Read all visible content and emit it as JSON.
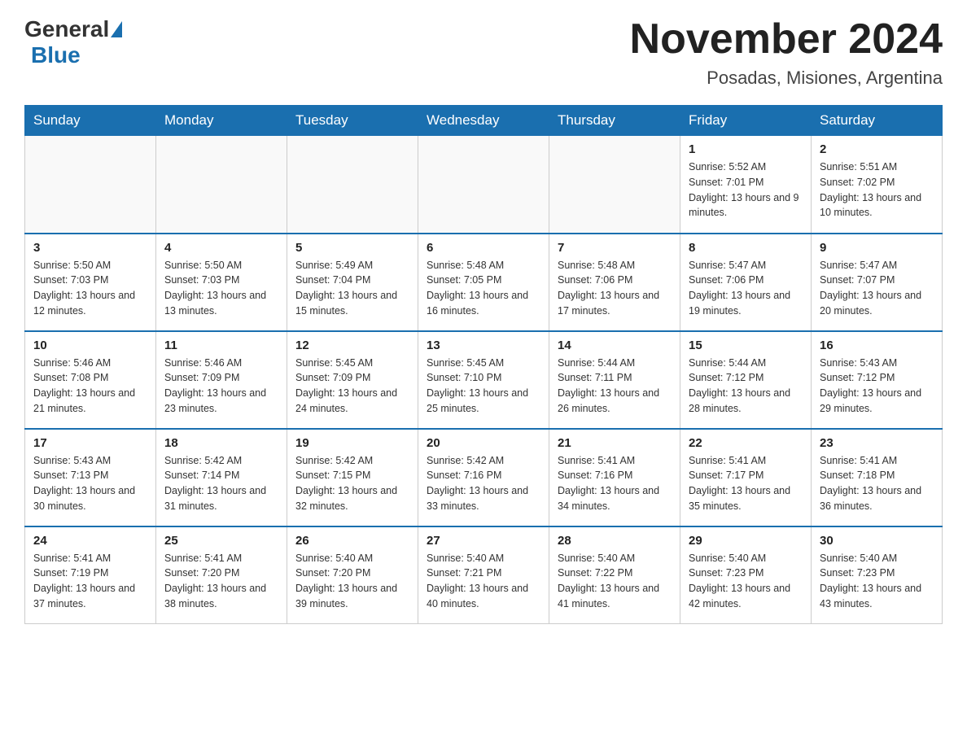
{
  "header": {
    "logo": {
      "general": "General",
      "blue": "Blue"
    },
    "title": "November 2024",
    "location": "Posadas, Misiones, Argentina"
  },
  "days_of_week": [
    "Sunday",
    "Monday",
    "Tuesday",
    "Wednesday",
    "Thursday",
    "Friday",
    "Saturday"
  ],
  "weeks": [
    [
      {
        "day": "",
        "info": ""
      },
      {
        "day": "",
        "info": ""
      },
      {
        "day": "",
        "info": ""
      },
      {
        "day": "",
        "info": ""
      },
      {
        "day": "",
        "info": ""
      },
      {
        "day": "1",
        "info": "Sunrise: 5:52 AM\nSunset: 7:01 PM\nDaylight: 13 hours and 9 minutes."
      },
      {
        "day": "2",
        "info": "Sunrise: 5:51 AM\nSunset: 7:02 PM\nDaylight: 13 hours and 10 minutes."
      }
    ],
    [
      {
        "day": "3",
        "info": "Sunrise: 5:50 AM\nSunset: 7:03 PM\nDaylight: 13 hours and 12 minutes."
      },
      {
        "day": "4",
        "info": "Sunrise: 5:50 AM\nSunset: 7:03 PM\nDaylight: 13 hours and 13 minutes."
      },
      {
        "day": "5",
        "info": "Sunrise: 5:49 AM\nSunset: 7:04 PM\nDaylight: 13 hours and 15 minutes."
      },
      {
        "day": "6",
        "info": "Sunrise: 5:48 AM\nSunset: 7:05 PM\nDaylight: 13 hours and 16 minutes."
      },
      {
        "day": "7",
        "info": "Sunrise: 5:48 AM\nSunset: 7:06 PM\nDaylight: 13 hours and 17 minutes."
      },
      {
        "day": "8",
        "info": "Sunrise: 5:47 AM\nSunset: 7:06 PM\nDaylight: 13 hours and 19 minutes."
      },
      {
        "day": "9",
        "info": "Sunrise: 5:47 AM\nSunset: 7:07 PM\nDaylight: 13 hours and 20 minutes."
      }
    ],
    [
      {
        "day": "10",
        "info": "Sunrise: 5:46 AM\nSunset: 7:08 PM\nDaylight: 13 hours and 21 minutes."
      },
      {
        "day": "11",
        "info": "Sunrise: 5:46 AM\nSunset: 7:09 PM\nDaylight: 13 hours and 23 minutes."
      },
      {
        "day": "12",
        "info": "Sunrise: 5:45 AM\nSunset: 7:09 PM\nDaylight: 13 hours and 24 minutes."
      },
      {
        "day": "13",
        "info": "Sunrise: 5:45 AM\nSunset: 7:10 PM\nDaylight: 13 hours and 25 minutes."
      },
      {
        "day": "14",
        "info": "Sunrise: 5:44 AM\nSunset: 7:11 PM\nDaylight: 13 hours and 26 minutes."
      },
      {
        "day": "15",
        "info": "Sunrise: 5:44 AM\nSunset: 7:12 PM\nDaylight: 13 hours and 28 minutes."
      },
      {
        "day": "16",
        "info": "Sunrise: 5:43 AM\nSunset: 7:12 PM\nDaylight: 13 hours and 29 minutes."
      }
    ],
    [
      {
        "day": "17",
        "info": "Sunrise: 5:43 AM\nSunset: 7:13 PM\nDaylight: 13 hours and 30 minutes."
      },
      {
        "day": "18",
        "info": "Sunrise: 5:42 AM\nSunset: 7:14 PM\nDaylight: 13 hours and 31 minutes."
      },
      {
        "day": "19",
        "info": "Sunrise: 5:42 AM\nSunset: 7:15 PM\nDaylight: 13 hours and 32 minutes."
      },
      {
        "day": "20",
        "info": "Sunrise: 5:42 AM\nSunset: 7:16 PM\nDaylight: 13 hours and 33 minutes."
      },
      {
        "day": "21",
        "info": "Sunrise: 5:41 AM\nSunset: 7:16 PM\nDaylight: 13 hours and 34 minutes."
      },
      {
        "day": "22",
        "info": "Sunrise: 5:41 AM\nSunset: 7:17 PM\nDaylight: 13 hours and 35 minutes."
      },
      {
        "day": "23",
        "info": "Sunrise: 5:41 AM\nSunset: 7:18 PM\nDaylight: 13 hours and 36 minutes."
      }
    ],
    [
      {
        "day": "24",
        "info": "Sunrise: 5:41 AM\nSunset: 7:19 PM\nDaylight: 13 hours and 37 minutes."
      },
      {
        "day": "25",
        "info": "Sunrise: 5:41 AM\nSunset: 7:20 PM\nDaylight: 13 hours and 38 minutes."
      },
      {
        "day": "26",
        "info": "Sunrise: 5:40 AM\nSunset: 7:20 PM\nDaylight: 13 hours and 39 minutes."
      },
      {
        "day": "27",
        "info": "Sunrise: 5:40 AM\nSunset: 7:21 PM\nDaylight: 13 hours and 40 minutes."
      },
      {
        "day": "28",
        "info": "Sunrise: 5:40 AM\nSunset: 7:22 PM\nDaylight: 13 hours and 41 minutes."
      },
      {
        "day": "29",
        "info": "Sunrise: 5:40 AM\nSunset: 7:23 PM\nDaylight: 13 hours and 42 minutes."
      },
      {
        "day": "30",
        "info": "Sunrise: 5:40 AM\nSunset: 7:23 PM\nDaylight: 13 hours and 43 minutes."
      }
    ]
  ]
}
